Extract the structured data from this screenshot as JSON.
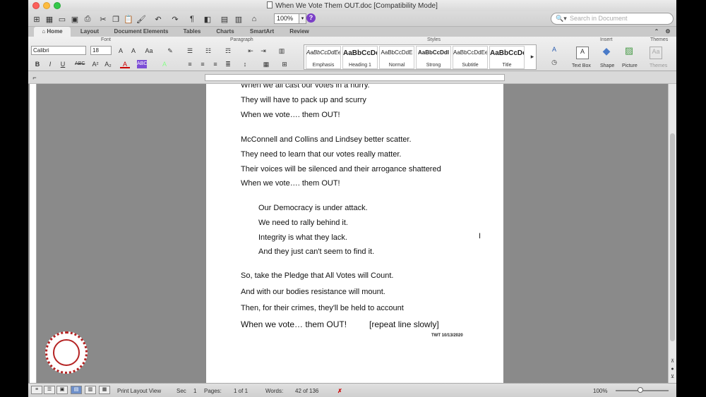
{
  "window": {
    "title": "When We Vote Them OUT.doc [Compatibility Mode]"
  },
  "toolbar": {
    "zoom": "100%",
    "search_placeholder": "Search in Document"
  },
  "tabs": [
    {
      "label": "Home",
      "active": true
    },
    {
      "label": "Layout"
    },
    {
      "label": "Document Elements"
    },
    {
      "label": "Tables"
    },
    {
      "label": "Charts"
    },
    {
      "label": "SmartArt"
    },
    {
      "label": "Review"
    }
  ],
  "ribbon": {
    "groups": {
      "font": "Font",
      "paragraph": "Paragraph",
      "styles": "Styles",
      "insert": "Insert",
      "themes": "Themes"
    },
    "font_name": "Calibri",
    "font_size": "18",
    "styles": [
      {
        "sample": "AaBbCcDdEe",
        "name": "Emphasis"
      },
      {
        "sample": "AaBbCcDc",
        "name": "Heading 1"
      },
      {
        "sample": "AaBbCcDdE",
        "name": "Normal"
      },
      {
        "sample": "AaBbCcDdI",
        "name": "Strong"
      },
      {
        "sample": "AaBbCcDdEe",
        "name": "Subtitle"
      },
      {
        "sample": "AaBbCcDc",
        "name": "Title"
      }
    ],
    "insert": [
      {
        "name": "Text Box"
      },
      {
        "name": "Shape"
      },
      {
        "name": "Picture"
      }
    ],
    "themes_label": "Themes"
  },
  "document": {
    "lines": [
      "When we all cast our votes in a hurry.",
      "They will have to pack up and scurry",
      "When we vote…. them OUT!",
      "McConnell and Collins and Lindsey better scatter.",
      "They need to learn that our votes really matter.",
      "Their voices will be silenced and their arrogance shattered",
      "When we vote…. them OUT!",
      "Our Democracy is under attack.",
      "We need to rally behind it.",
      "Integrity is what they lack.",
      "And they just can't seem to find it.",
      "So, take the Pledge that All Votes will Count.",
      "And with our bodies resistance will mount.",
      "Then, for their crimes, they'll be held to account",
      "When we vote… them OUT!",
      "[repeat line slowly]"
    ],
    "signature": "TWT 10/13/2020"
  },
  "status": {
    "view": "Print Layout View",
    "sec_label": "Sec",
    "sec_value": "1",
    "pages_label": "Pages:",
    "pages_value": "1 of 1",
    "words_label": "Words:",
    "words_value": "42 of 136",
    "zoom": "100%"
  }
}
